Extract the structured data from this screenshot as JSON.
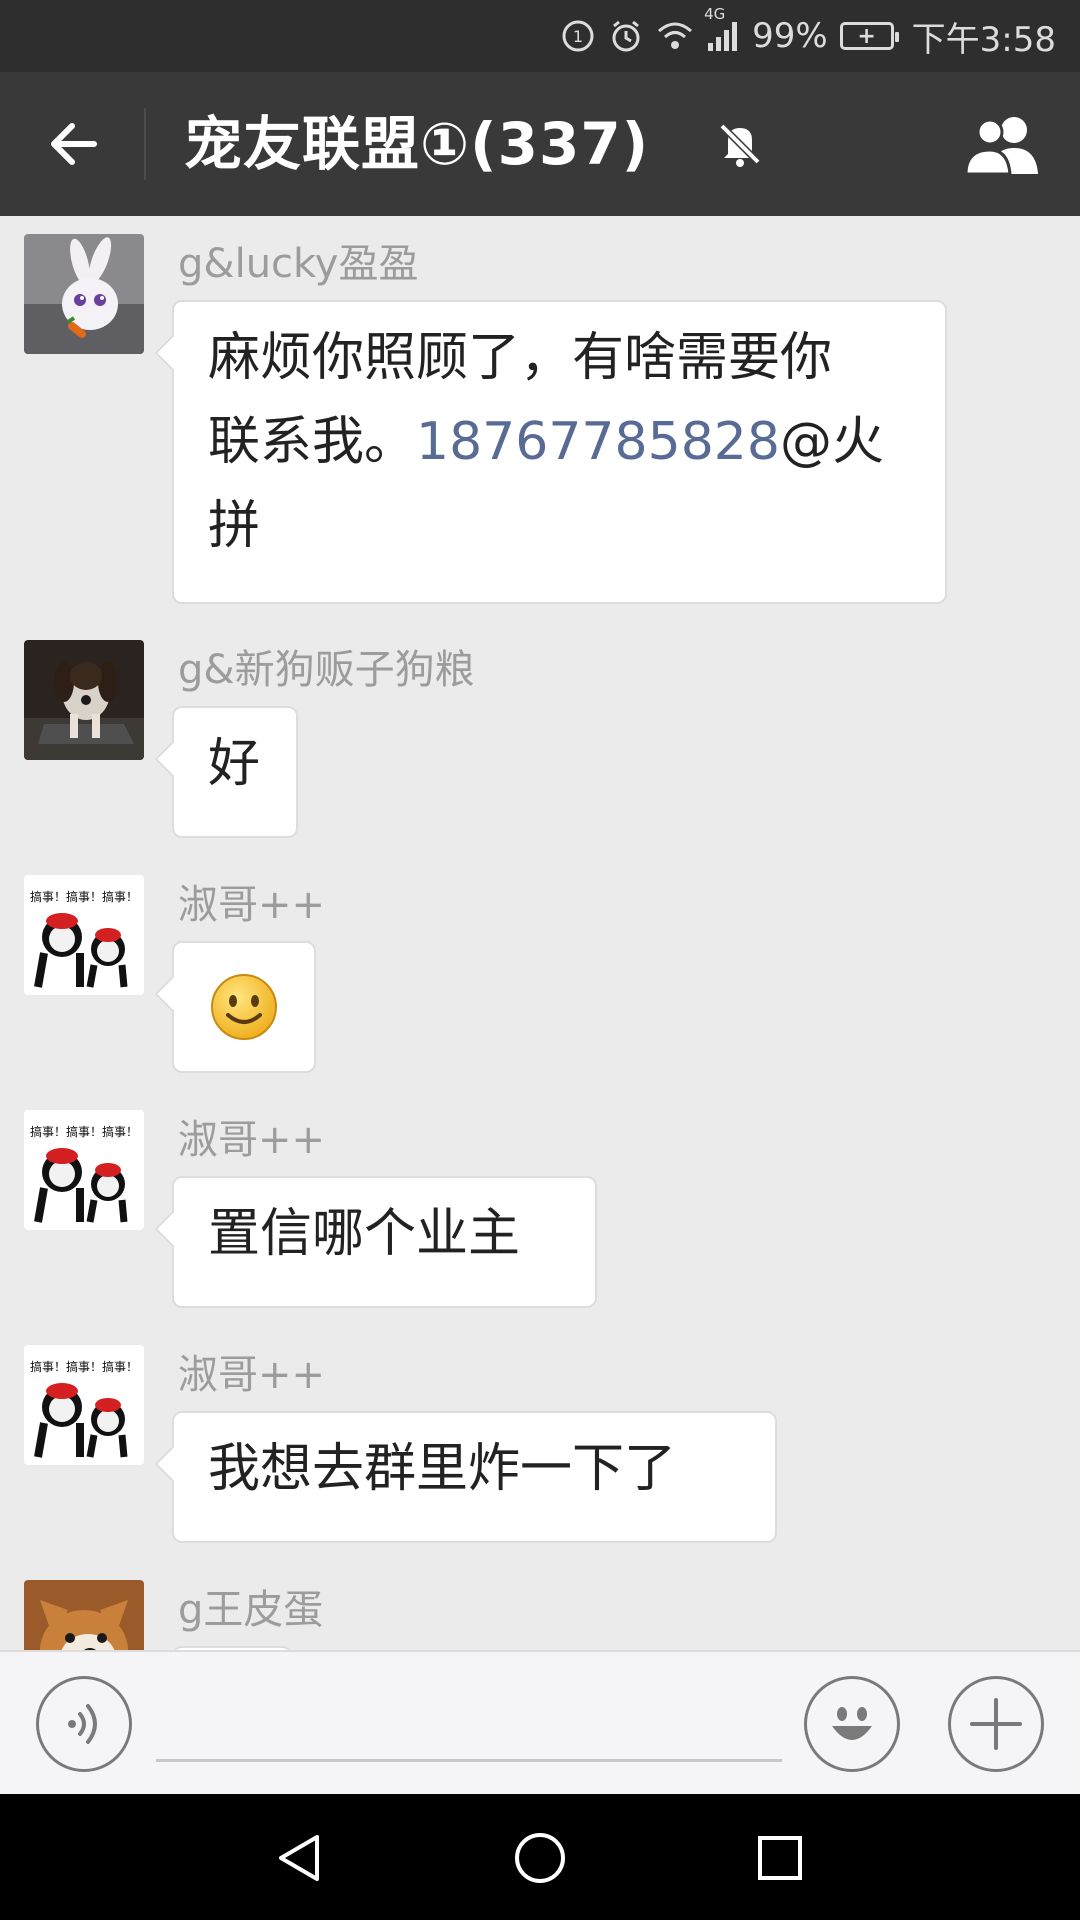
{
  "status_bar": {
    "battery": "99%",
    "battery_plus": "+",
    "network": "4G",
    "time": "下午3:58"
  },
  "header": {
    "title": "宠友联盟①(337)",
    "back_icon": "arrow-left-icon",
    "mute_icon": "bell-off-icon",
    "members_icon": "group-members-icon"
  },
  "messages": [
    {
      "sender": "g&lucky盈盈",
      "avatar": "white-rabbit",
      "text_line1": "麻烦你照顾了，有啥需要你",
      "text_line2_prefix": "联系我。",
      "phone": "18767785828",
      "text_line2_suffix": "@火",
      "text_line3": "拼"
    },
    {
      "sender": "g&新狗贩子狗粮",
      "avatar": "puppy",
      "text": "好"
    },
    {
      "sender": "淑哥++",
      "avatar": "panda-meme",
      "emoji": "smile-emoji"
    },
    {
      "sender": "淑哥++",
      "avatar": "panda-meme",
      "text": "置信哪个业主"
    },
    {
      "sender": "淑哥++",
      "avatar": "panda-meme",
      "text": "我想去群里炸一下了"
    },
    {
      "sender": "g王皮蛋",
      "avatar": "corgi"
    }
  ],
  "avatar_meme_caption": "搞事！搞事！搞事！",
  "input_bar": {
    "voice_icon": "voice-icon",
    "emoji_icon": "emoji-icon",
    "plus_icon": "plus-icon",
    "input_value": ""
  },
  "nav": {
    "back": "triangle-back-icon",
    "home": "circle-home-icon",
    "recents": "square-recents-icon"
  },
  "colors": {
    "header_bg": "#393939",
    "status_bg": "#2e2e2e",
    "chat_bg": "#ebebeb",
    "link": "#576b95"
  }
}
